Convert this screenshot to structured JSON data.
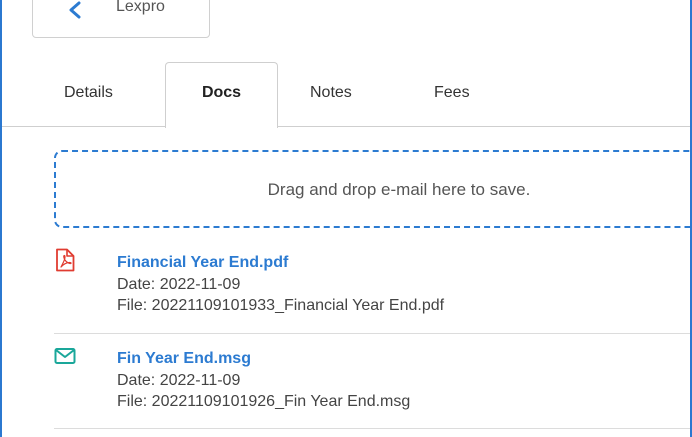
{
  "back_button": {
    "label": "Lexpro"
  },
  "tabs": [
    {
      "label": "Details",
      "active": false
    },
    {
      "label": "Docs",
      "active": true
    },
    {
      "label": "Notes",
      "active": false
    },
    {
      "label": "Fees",
      "active": false
    }
  ],
  "dropzone": {
    "text": "Drag and drop e-mail here to save."
  },
  "documents": [
    {
      "icon": "pdf-icon",
      "icon_color": "#e03c31",
      "title": "Financial Year End.pdf",
      "date": "Date: 2022-11-09",
      "file": "File: 20221109101933_Financial Year End.pdf"
    },
    {
      "icon": "mail-icon",
      "icon_color": "#1aa79a",
      "title": "Fin Year End.msg",
      "date": "Date: 2022-11-09",
      "file": "File: 20221109101926_Fin Year End.msg"
    }
  ],
  "colors": {
    "accent": "#2c7bd1",
    "frame_border": "#2b78d0"
  }
}
